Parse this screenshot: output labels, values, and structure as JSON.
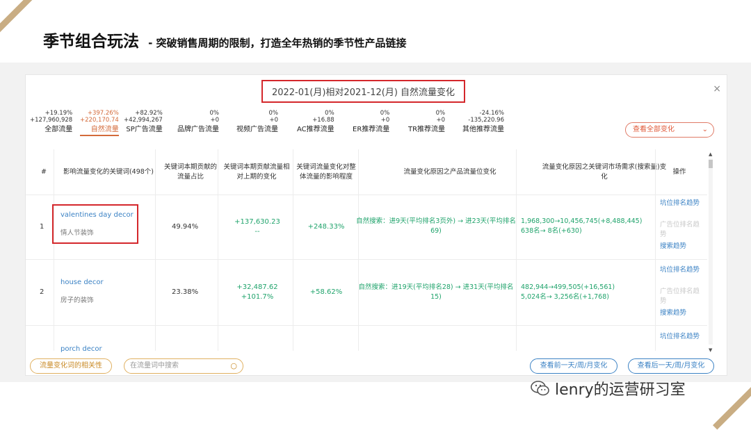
{
  "slide": {
    "title": "季节组合玩法",
    "subtitle": "- 突破销售周期的限制，打造全年热销的季节性产品链接"
  },
  "panel": {
    "title": "2022-01(月)相对2021-12(月) 自然流量变化",
    "close": "×"
  },
  "tabs": [
    {
      "pct": "+19.19%",
      "val": "+127,960,928",
      "label": "全部流量"
    },
    {
      "pct": "+397.26%",
      "val": "+220,170.74",
      "label": "自然流量",
      "active": true
    },
    {
      "pct": "+82.92%",
      "val": "+42,994,267",
      "label": "SP广告流量"
    },
    {
      "pct": "0%",
      "val": "+0",
      "label": "品牌广告流量"
    },
    {
      "pct": "0%",
      "val": "+0",
      "label": "视频广告流量"
    },
    {
      "pct": "0%",
      "val": "+16.88",
      "label": "AC推荐流量"
    },
    {
      "pct": "0%",
      "val": "+0",
      "label": "ER推荐流量"
    },
    {
      "pct": "0%",
      "val": "+0",
      "label": "TR推荐流量"
    },
    {
      "pct": "-24.16%",
      "val": "-135,220.96",
      "label": "其他推荐流量"
    }
  ],
  "view_all": "查看全部变化",
  "headers": {
    "num": "#",
    "keyword": "影响流量变化的关键词(498个)",
    "share": "关键词本期贡献的流量占比",
    "change": "关键词本期贡献流量相对上期的变化",
    "impact": "关键词流量变化对整体流量的影响程度",
    "reason_product": "流量变化原因之产品流量位变化",
    "reason_market": "流量变化原因之关键词市场需求(搜索量)变化",
    "ops": "操作"
  },
  "rows": [
    {
      "num": "1",
      "kw": "valentines day decor",
      "kw_cn": "情人节装饰",
      "share": "49.94%",
      "change1": "+137,630.23",
      "change2": "--",
      "impact": "+248.33%",
      "reason1": "自然搜索：进9天(平均排名3页外) → 进23天(平均排名69)",
      "reason2a": "1,968,300→10,456,745(+8,488,445)",
      "reason2b": "638名→ 8名(+630)",
      "op1": "坑位排名趋势",
      "op2": "广告位排名趋势",
      "op3": "搜索趋势"
    },
    {
      "num": "2",
      "kw": "house decor",
      "kw_cn": "房子的装饰",
      "share": "23.38%",
      "change1": "+32,487.62",
      "change2": "+101.7%",
      "impact": "+58.62%",
      "reason1": "自然搜索：进19天(平均排名28) → 进31天(平均排名15)",
      "reason2a": "482,944→499,505(+16,561)",
      "reason2b": "5,024名→ 3,256名(+1,768)",
      "op1": "坑位排名趋势",
      "op2": "广告位排名趋势",
      "op3": "搜索趋势"
    },
    {
      "kw": "porch decor",
      "op1": "坑位排名趋势"
    }
  ],
  "footer": {
    "related": "流量变化词的相关性",
    "search_placeholder": "在流量词中搜索",
    "prev": "查看前一天/周/月变化",
    "next": "查看后一天/周/月变化"
  },
  "watermark": "lenry的运营研习室",
  "colors": {
    "accent": "#d4272b",
    "active_tab": "#d46a3a",
    "positive": "#1fa36b",
    "link": "#3b82c4",
    "corner": "#c9ad83"
  }
}
